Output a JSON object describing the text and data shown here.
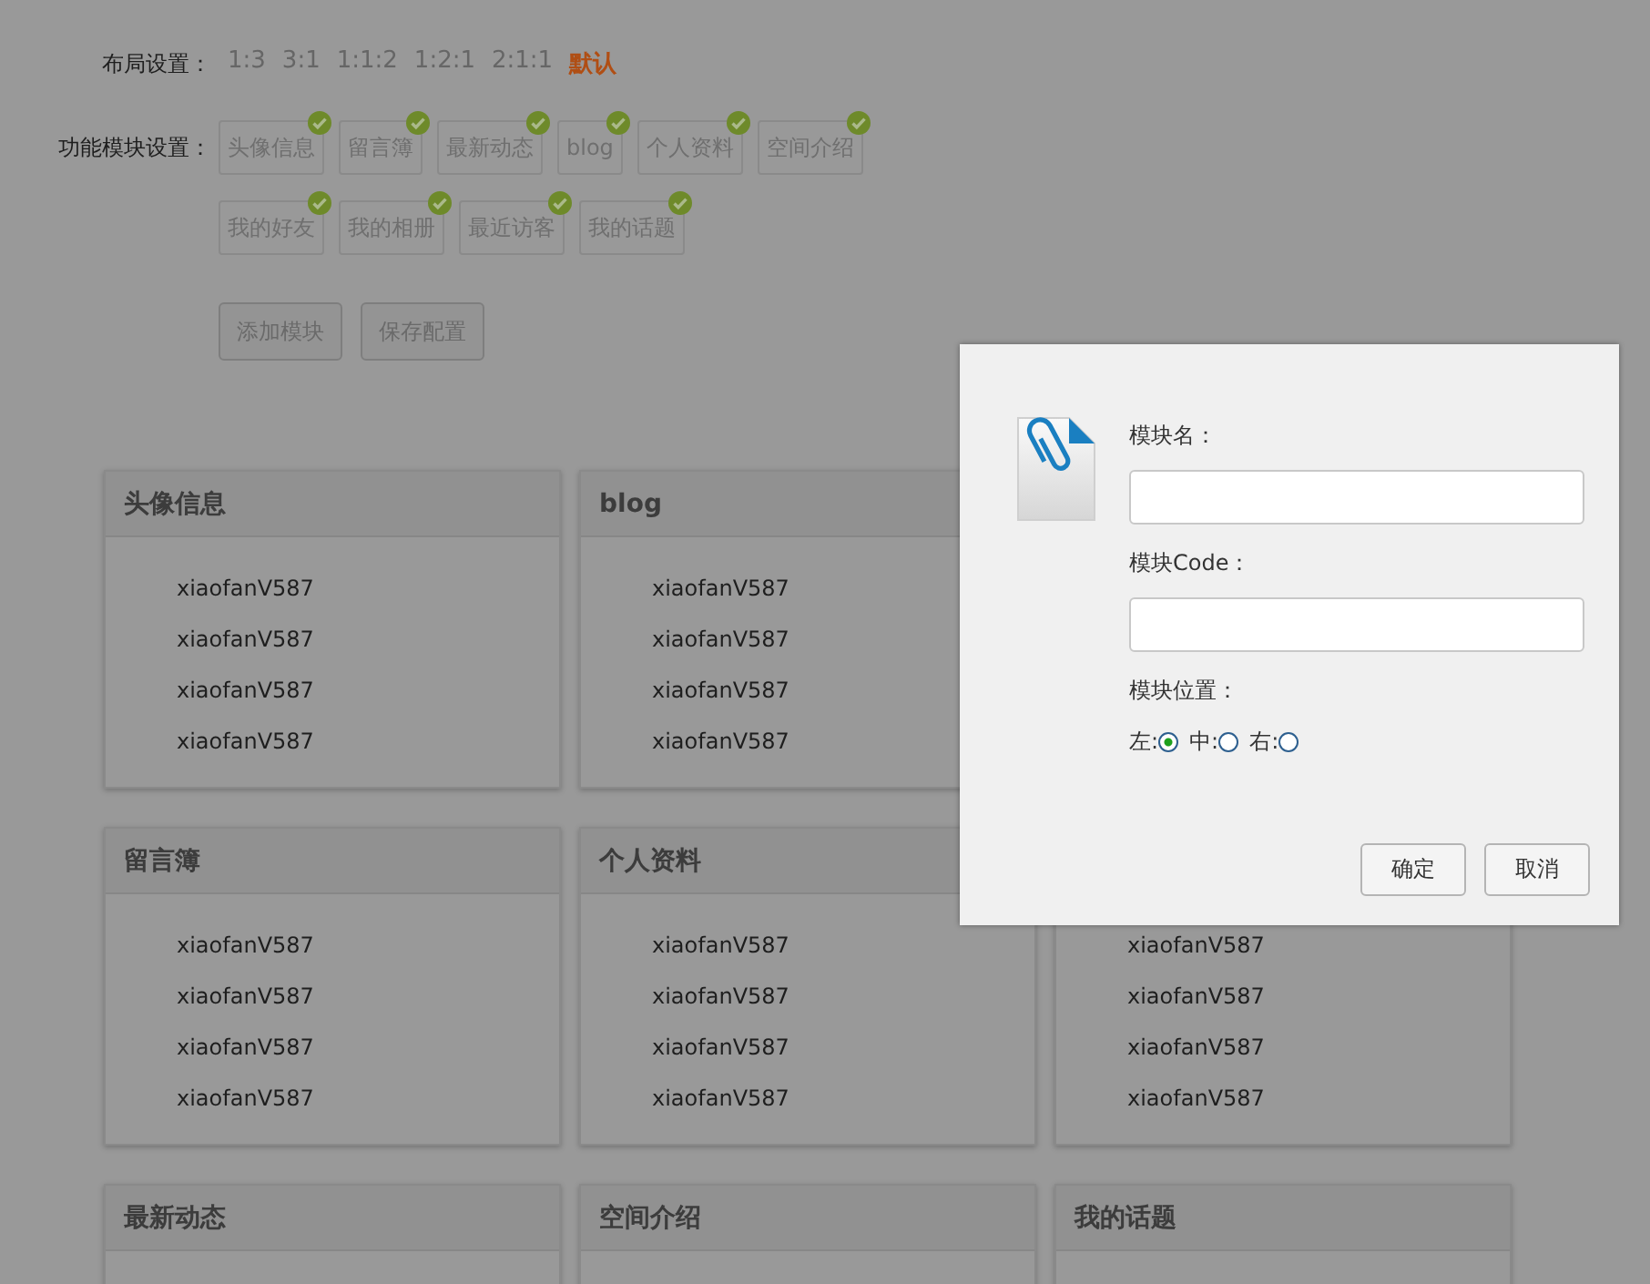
{
  "layout": {
    "label": "布局设置：",
    "options": [
      {
        "label": "1:3",
        "selected": false
      },
      {
        "label": "3:1",
        "selected": false
      },
      {
        "label": "1:1:2",
        "selected": false
      },
      {
        "label": "1:2:1",
        "selected": false
      },
      {
        "label": "2:1:1",
        "selected": false
      },
      {
        "label": "默认",
        "selected": true
      }
    ]
  },
  "modules": {
    "label": "功能模块设置：",
    "rows": [
      [
        {
          "label": "头像信息",
          "checked": true
        },
        {
          "label": "留言簿",
          "checked": true
        },
        {
          "label": "最新动态",
          "checked": true
        },
        {
          "label": "blog",
          "checked": true
        },
        {
          "label": "个人资料",
          "checked": true
        },
        {
          "label": "空间介绍",
          "checked": true
        }
      ],
      [
        {
          "label": "我的好友",
          "checked": true
        },
        {
          "label": "我的相册",
          "checked": true
        },
        {
          "label": "最近访客",
          "checked": true
        },
        {
          "label": "我的话题",
          "checked": true
        }
      ]
    ]
  },
  "actions": [
    "添加模块",
    "保存配置"
  ],
  "card_rows": [
    {
      "cards": [
        {
          "title": "头像信息",
          "items": [
            "xiaofanV587",
            "xiaofanV587",
            "xiaofanV587",
            "xiaofanV587"
          ]
        },
        {
          "title": "blog",
          "items": [
            "xiaofanV587",
            "xiaofanV587",
            "xiaofanV587",
            "xiaofanV587"
          ]
        }
      ]
    },
    {
      "cards": [
        {
          "title": "留言簿",
          "items": [
            "xiaofanV587",
            "xiaofanV587",
            "xiaofanV587",
            "xiaofanV587"
          ]
        },
        {
          "title": "个人资料",
          "items": [
            "xiaofanV587",
            "xiaofanV587",
            "xiaofanV587",
            "xiaofanV587"
          ]
        },
        {
          "items": [
            "xiaofanV587",
            "xiaofanV587",
            "xiaofanV587",
            "xiaofanV587"
          ]
        }
      ]
    },
    {
      "cards": [
        {
          "title": "最新动态"
        },
        {
          "title": "空间介绍"
        },
        {
          "title": "我的话题"
        }
      ]
    }
  ],
  "dialog": {
    "name_label": "模块名：",
    "code_label": "模块Code：",
    "position_label": "模块位置：",
    "positions": [
      {
        "label": "左:",
        "selected": true
      },
      {
        "label": "中:",
        "selected": false
      },
      {
        "label": "右:",
        "selected": false
      }
    ],
    "buttons": [
      "确定",
      "取消"
    ]
  }
}
